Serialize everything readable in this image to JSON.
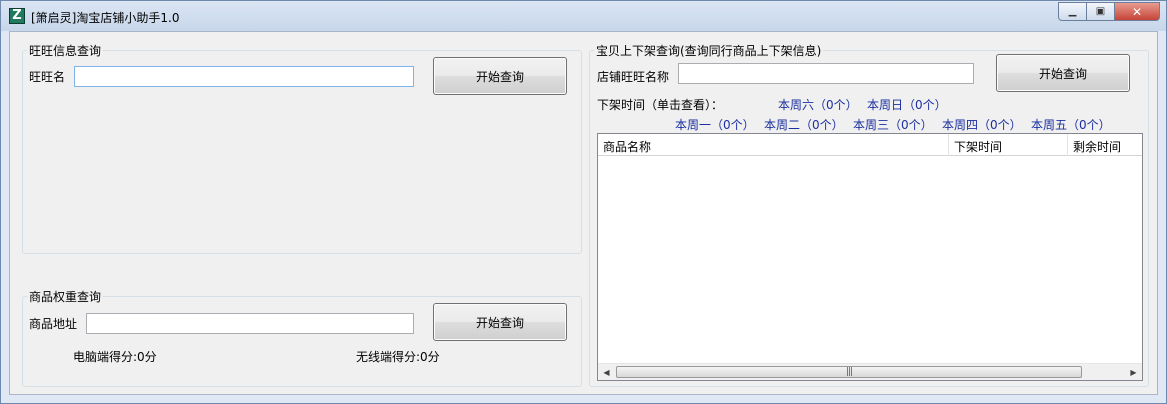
{
  "window": {
    "title": "[箫启灵]淘宝店铺小助手1.0",
    "app_icon_letter": "Z",
    "minimize_icon": "minimize-icon",
    "maximize_icon": "maximize-icon",
    "close_icon": "close-icon"
  },
  "wangwang_query": {
    "group_title": "旺旺信息查询",
    "name_label": "旺旺名",
    "name_value": "",
    "button_label": "开始查询"
  },
  "weight_query": {
    "group_title": "商品权重查询",
    "address_label": "商品地址",
    "address_value": "",
    "button_label": "开始查询",
    "pc_score_label": "电脑端得分:",
    "pc_score_value": "0分",
    "mobile_score_label": "无线端得分:",
    "mobile_score_value": "0分"
  },
  "listing_query": {
    "group_title": "宝贝上下架查询(查询同行商品上下架信息)",
    "shop_label": "店铺旺旺名称",
    "shop_value": "",
    "button_label": "开始查询",
    "delist_label": "下架时间（单击查看）：",
    "days": {
      "sat": "本周六（0个）",
      "sun": "本周日（0个）",
      "mon": "本周一（0个）",
      "tue": "本周二（0个）",
      "wed": "本周三（0个）",
      "thu": "本周四（0个）",
      "fri": "本周五（0个）"
    },
    "columns": [
      "商品名称",
      "下架时间",
      "剩余时间"
    ],
    "rows": []
  },
  "colors": {
    "link": "#1b2fa0",
    "window_frame": "#dfe8f4",
    "client_bg": "#f0f0f0"
  }
}
